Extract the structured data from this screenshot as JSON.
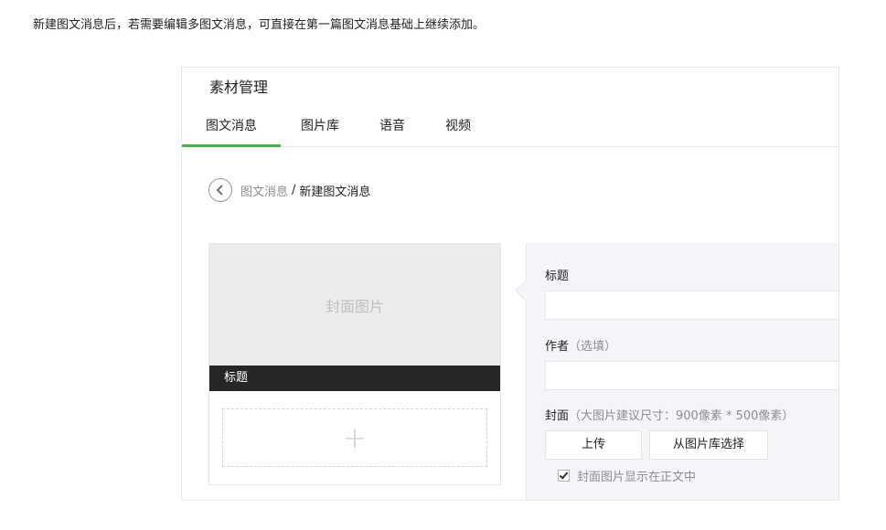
{
  "intro_text": "新建图文消息后，若需要编辑多图文消息，可直接在第一篇图文消息基础上继续添加。",
  "panel": {
    "title": "素材管理",
    "tabs": [
      {
        "label": "图文消息",
        "active": true
      },
      {
        "label": "图片库",
        "active": false
      },
      {
        "label": "语音",
        "active": false
      },
      {
        "label": "视频",
        "active": false
      }
    ]
  },
  "breadcrumb": {
    "back_icon": "chevron-left-icon",
    "link": "图文消息",
    "separator": "/",
    "current": "新建图文消息"
  },
  "preview": {
    "cover_placeholder": "封面图片",
    "title": "标题",
    "add_icon": "plus-icon"
  },
  "editor": {
    "title_label": "标题",
    "title_value": "",
    "author_label": "作者",
    "author_hint": "（选填）",
    "author_value": "",
    "cover_label": "封面",
    "cover_hint": "（大图片建议尺寸：900像素 * 500像素）",
    "upload_button": "上传",
    "library_button": "从图片库选择",
    "show_cover_label": "封面图片显示在正文中",
    "show_cover_checked": true
  },
  "colors": {
    "accent": "#44b549",
    "border": "#e7e7eb",
    "editor_bg": "#f4f5f9",
    "cover_bg": "#ececec",
    "title_bar_bg": "#262626",
    "muted_text": "#8d8d8d"
  }
}
